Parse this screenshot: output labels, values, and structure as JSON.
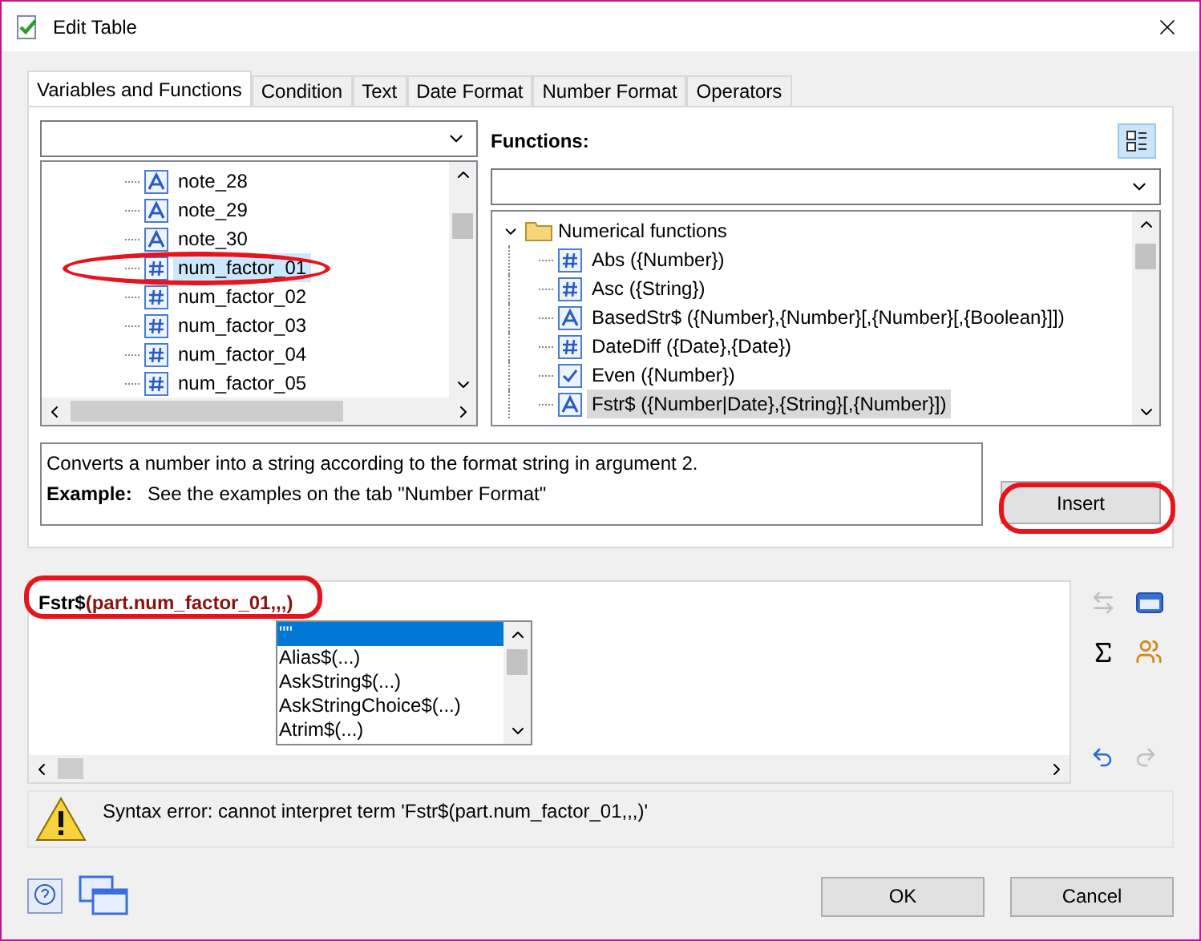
{
  "window": {
    "title": "Edit Table"
  },
  "tabs": [
    {
      "label": "Variables and Functions",
      "selected": true
    },
    {
      "label": "Condition",
      "selected": false
    },
    {
      "label": "Text",
      "selected": false
    },
    {
      "label": "Date Format",
      "selected": false
    },
    {
      "label": "Number Format",
      "selected": false
    },
    {
      "label": "Operators",
      "selected": false
    }
  ],
  "variables": {
    "items": [
      {
        "label": "note_28",
        "kind": "string",
        "selected": false
      },
      {
        "label": "note_29",
        "kind": "string",
        "selected": false
      },
      {
        "label": "note_30",
        "kind": "string",
        "selected": false
      },
      {
        "label": "num_factor_01",
        "kind": "number",
        "selected": true
      },
      {
        "label": "num_factor_02",
        "kind": "number",
        "selected": false
      },
      {
        "label": "num_factor_03",
        "kind": "number",
        "selected": false
      },
      {
        "label": "num_factor_04",
        "kind": "number",
        "selected": false
      },
      {
        "label": "num_factor_05",
        "kind": "number",
        "selected": false
      }
    ]
  },
  "functions": {
    "label": "Functions:",
    "group": {
      "label": "Numerical functions",
      "expanded": true,
      "children": [
        {
          "label": "Abs ({Number})",
          "kind": "number",
          "selected": false
        },
        {
          "label": "Asc ({String})",
          "kind": "number",
          "selected": false
        },
        {
          "label": "BasedStr$ ({Number},{Number}[,{Number}[,{Boolean}]])",
          "kind": "string",
          "selected": false
        },
        {
          "label": "DateDiff ({Date},{Date})",
          "kind": "number",
          "selected": false
        },
        {
          "label": "Even ({Number})",
          "kind": "bool",
          "selected": false
        },
        {
          "label": "Fstr$ ({Number|Date},{String}[,{Number}])",
          "kind": "string",
          "selected": true
        }
      ]
    }
  },
  "description": {
    "text": "Converts a number into a string according to the format string in argument 2.",
    "example_label": "Example:",
    "example": "See the examples on the tab \"Number Format\""
  },
  "insert_button": "Insert",
  "editor": {
    "function": "Fstr$",
    "arguments": "(part.num_factor_01,,,)"
  },
  "autocomplete": {
    "items": [
      {
        "label": "\"\"",
        "selected": true
      },
      {
        "label": "Alias$(...)",
        "selected": false
      },
      {
        "label": "AskString$(...)",
        "selected": false
      },
      {
        "label": "AskStringChoice$(...)",
        "selected": false
      },
      {
        "label": "Atrim$(...)",
        "selected": false
      }
    ]
  },
  "error": {
    "message": "Syntax error: cannot interpret term 'Fstr$(part.num_factor_01,,,)'"
  },
  "buttons": [
    {
      "label": "OK"
    },
    {
      "label": "Cancel"
    }
  ]
}
